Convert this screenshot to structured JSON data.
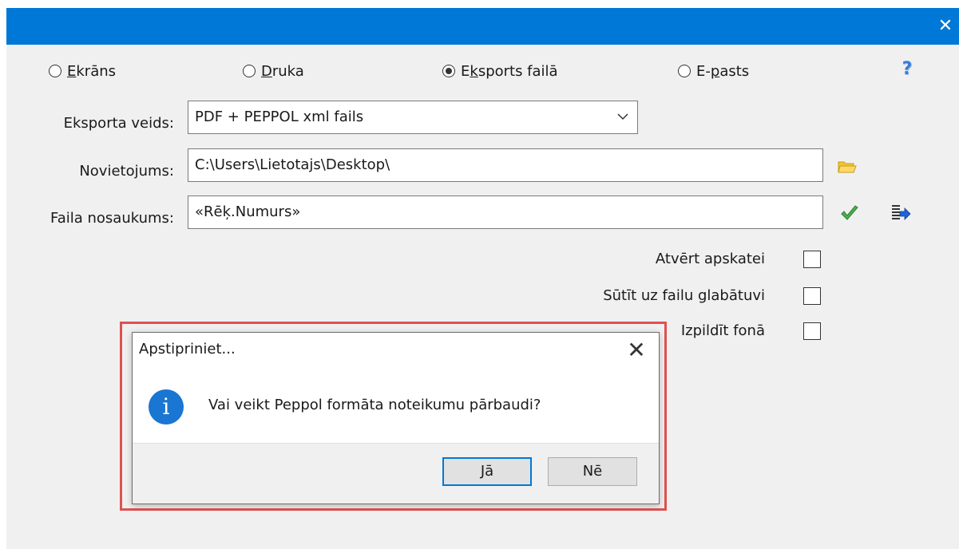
{
  "window": {
    "close_symbol": "✕"
  },
  "output_options": [
    {
      "label_underlined": "E",
      "label_rest": "krāns",
      "checked": false
    },
    {
      "label_underlined": "D",
      "label_rest": "ruka",
      "checked": false
    },
    {
      "label_pre": "E",
      "label_underlined": "k",
      "label_rest": "sports failā",
      "checked": true
    },
    {
      "label_pre": "E-",
      "label_underlined": "p",
      "label_rest": "asts",
      "checked": false
    }
  ],
  "help": {
    "icon": "help-question-icon",
    "symbol": "?"
  },
  "form": {
    "export_type_label": "Eksporta veids:",
    "export_type_value": "PDF + PEPPOL xml fails",
    "location_label": "Novietojums:",
    "location_value": "C:\\Users\\Lietotajs\\Desktop\\",
    "filename_label": "Faila nosaukums:",
    "filename_value": "«Rēķ.Numurs»"
  },
  "checkboxes": [
    {
      "label": "Atvērt apskatei",
      "checked": false
    },
    {
      "label": "Sūtīt uz failu glabātuvi",
      "checked": false
    },
    {
      "label": "Izpildīt fonā",
      "checked": false
    }
  ],
  "dialog": {
    "title": "Apstipriniet...",
    "close_symbol": "✕",
    "icon_text": "i",
    "message": "Vai veikt Peppol formāta noteikumu pārbaudi?",
    "yes_label": "Jā",
    "no_label": "Nē"
  },
  "colors": {
    "titlebar": "#0078d7",
    "highlight_border": "#e05050",
    "info_icon": "#1976d2"
  }
}
